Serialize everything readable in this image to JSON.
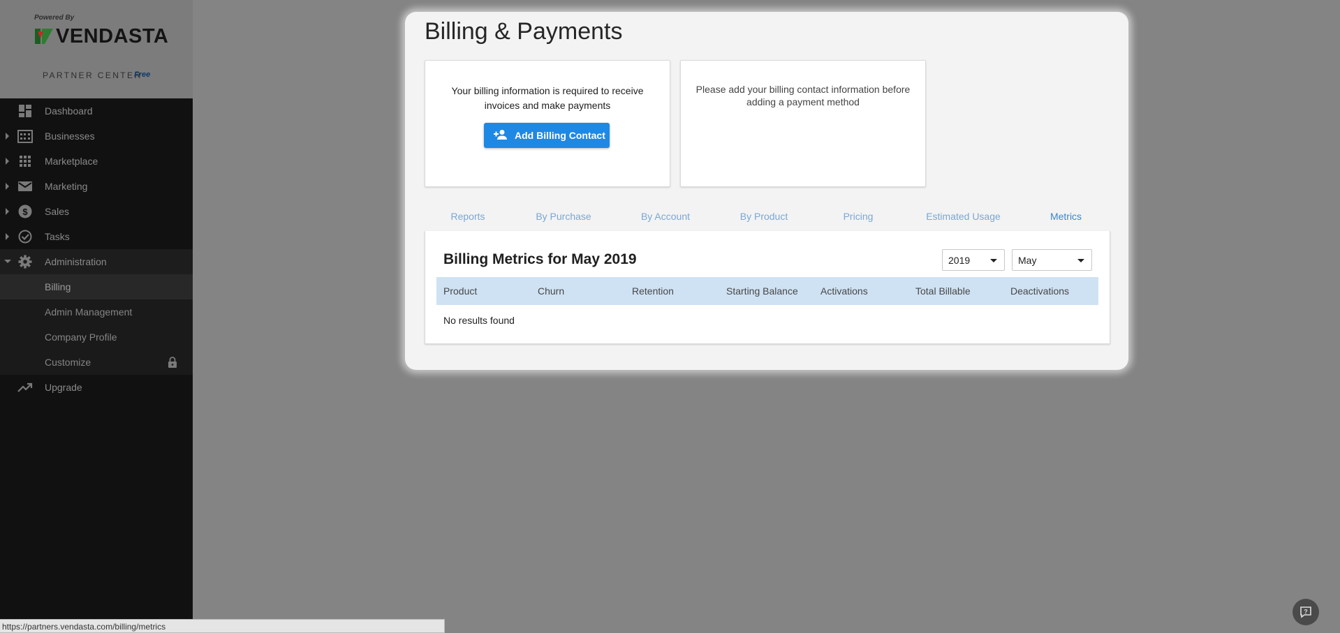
{
  "brand": {
    "powered_by": "Powered By",
    "logo": "VENDASTA",
    "partner_center": "PARTNER CENTER",
    "plan": "Free"
  },
  "nav": {
    "items": [
      {
        "label": "Dashboard",
        "icon": "dashboard-icon",
        "expandable": false
      },
      {
        "label": "Businesses",
        "icon": "building-icon",
        "expandable": true
      },
      {
        "label": "Marketplace",
        "icon": "grid-icon",
        "expandable": true
      },
      {
        "label": "Marketing",
        "icon": "mail-icon",
        "expandable": true
      },
      {
        "label": "Sales",
        "icon": "dollar-icon",
        "expandable": true
      },
      {
        "label": "Tasks",
        "icon": "check-circle-icon",
        "expandable": true
      },
      {
        "label": "Administration",
        "icon": "gear-icon",
        "expandable": true,
        "expanded": true
      }
    ],
    "admin_sub": [
      {
        "label": "Billing",
        "active": true
      },
      {
        "label": "Admin Management"
      },
      {
        "label": "Company Profile"
      },
      {
        "label": "Customize",
        "icon": "lock-icon"
      }
    ],
    "upgrade": {
      "label": "Upgrade",
      "icon": "trending-up-icon"
    }
  },
  "page": {
    "title": "Billing & Payments"
  },
  "billing_card": {
    "text": "Your billing information is required to receive invoices and make payments",
    "button_label": "Add Billing Contact"
  },
  "payment_card": {
    "text": "Please add your billing contact information before adding a payment method"
  },
  "tabs": [
    {
      "label": "Reports"
    },
    {
      "label": "By Purchase"
    },
    {
      "label": "By Account"
    },
    {
      "label": "By Product"
    },
    {
      "label": "Pricing"
    },
    {
      "label": "Estimated Usage"
    },
    {
      "label": "Metrics",
      "active": true
    }
  ],
  "metrics": {
    "title": "Billing Metrics for May 2019",
    "year_selected": "2019",
    "month_selected": "May",
    "columns": [
      "Product",
      "Churn",
      "Retention",
      "Starting Balance",
      "Activations",
      "Total Billable",
      "Deactivations"
    ],
    "empty_message": "No results found"
  },
  "status_url": "https://partners.vendasta.com/billing/metrics",
  "colors": {
    "accent": "#1e88e5",
    "tab_text": "#79a7d4",
    "table_header_bg": "#cfe2f3",
    "sidebar_bg": "#111111"
  }
}
